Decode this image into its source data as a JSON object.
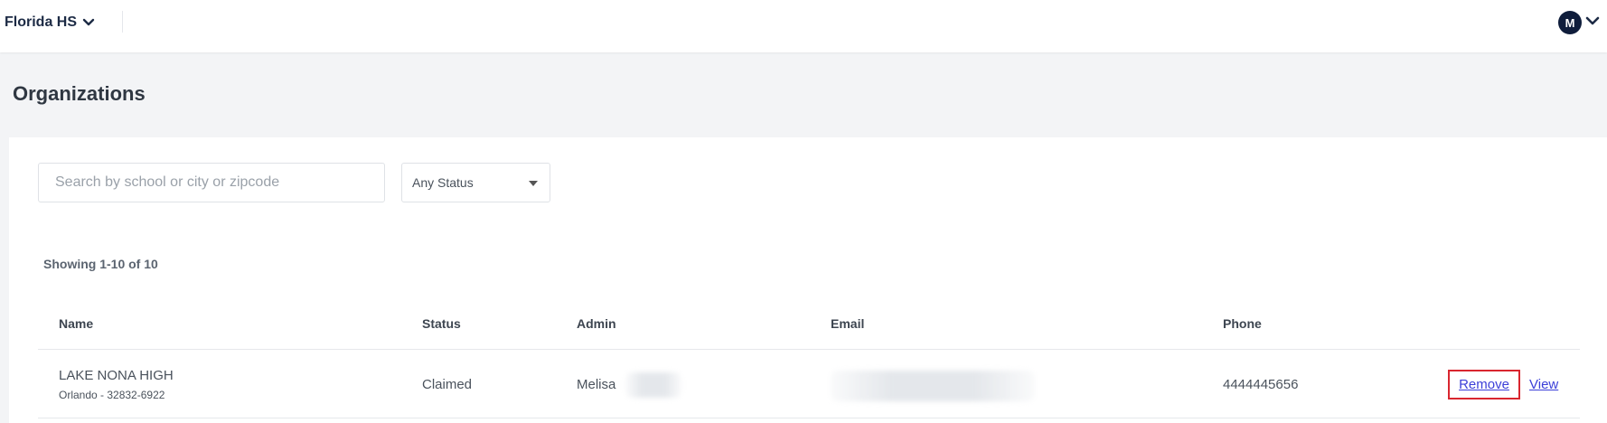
{
  "header": {
    "org_name": "Florida HS",
    "user_initial": "M"
  },
  "page": {
    "title": "Organizations"
  },
  "filters": {
    "search_placeholder": "Search by school or city or zipcode",
    "search_value": "",
    "status_selected": "Any Status"
  },
  "results": {
    "showing_text": "Showing 1-10 of 10"
  },
  "table": {
    "columns": [
      "Name",
      "Status",
      "Admin",
      "Email",
      "Phone"
    ],
    "rows": [
      {
        "name": "LAKE NONA HIGH",
        "location": "Orlando - 32832-6922",
        "status": "Claimed",
        "admin": "Melisa",
        "phone": "4444445656",
        "remove_label": "Remove",
        "view_label": "View"
      }
    ]
  },
  "colors": {
    "accent_link": "#3b3fd8",
    "highlight_border": "#d9262f",
    "avatar_bg": "#0f1d3b"
  },
  "icons": {
    "org_dropdown": "chevron-down-icon",
    "user_dropdown": "chevron-down-icon",
    "status_caret": "caret-down-icon"
  }
}
